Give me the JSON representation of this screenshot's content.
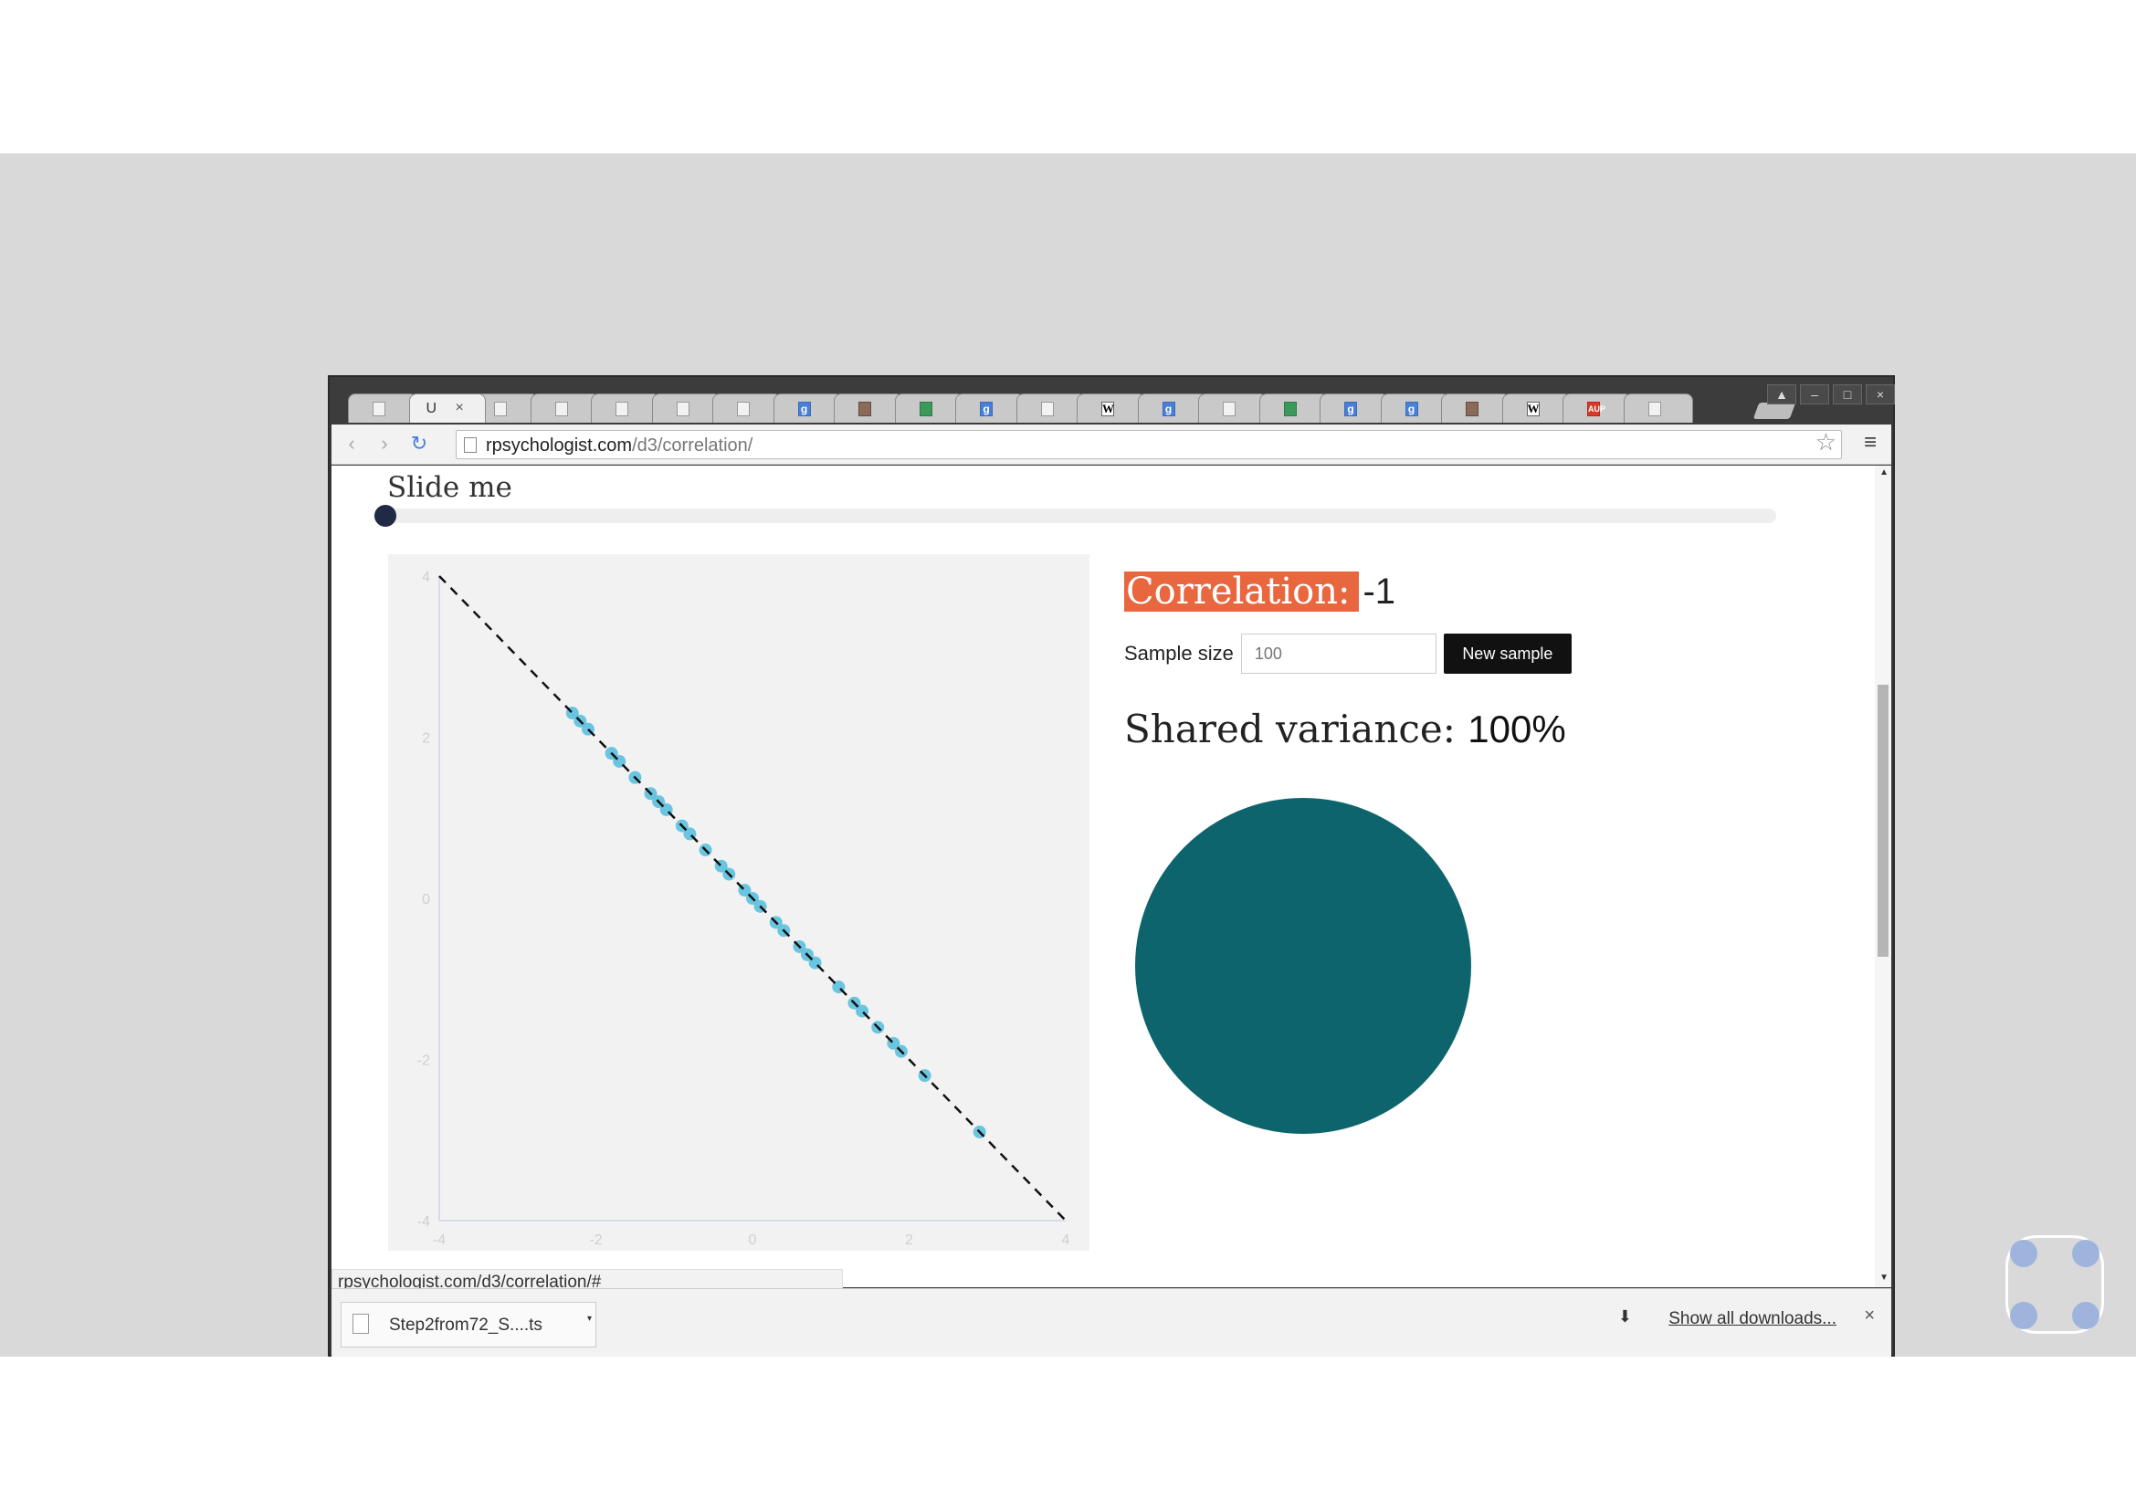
{
  "browser": {
    "active_tab_title": "U",
    "active_tab_close": "×",
    "tabs": [
      "doc",
      "doc",
      "doc",
      "doc",
      "doc",
      "doc",
      "g",
      "pic",
      "gr",
      "g",
      "doc",
      "W",
      "g",
      "doc",
      "gr",
      "g",
      "g",
      "pic",
      "W",
      "AUP",
      "doc"
    ],
    "url_host": "rpsychologist.com",
    "url_path": "/d3/correlation/",
    "window_buttons": [
      "▲",
      "–",
      "□",
      "×"
    ]
  },
  "page": {
    "slider_label": "Slide me",
    "slider_value": 0,
    "correlation_label": "Correlation:",
    "correlation_value": "-1",
    "sample_size_label": "Sample size",
    "sample_size_placeholder": "100",
    "new_sample_button": "New sample",
    "shared_variance_label": "Shared variance:",
    "shared_variance_value": "100%",
    "circle_color": "#0e646c",
    "point_color": "#5bc0de",
    "accent_color": "#e8673f"
  },
  "status_bar": {
    "link_url": "rpsychologist.com/d3/correlation/#"
  },
  "downloads": {
    "file_name": "Step2from72_S....ts",
    "show_all": "Show all downloads..."
  },
  "chart_data": {
    "type": "scatter",
    "x_ticks": [
      -4,
      -2,
      0,
      2,
      4
    ],
    "y_ticks": [
      4,
      2,
      0,
      -2,
      -4
    ],
    "xlim": [
      -4,
      4
    ],
    "ylim": [
      -4,
      4
    ],
    "regression_line": {
      "x": [
        -4,
        4
      ],
      "y": [
        4,
        -4
      ],
      "style": "dashed"
    },
    "points_x": [
      -2.3,
      -2.2,
      -2.1,
      -1.8,
      -1.7,
      -1.5,
      -1.3,
      -1.2,
      -1.1,
      -0.9,
      -0.8,
      -0.6,
      -0.4,
      -0.3,
      -0.1,
      0.0,
      0.1,
      0.3,
      0.4,
      0.6,
      0.7,
      0.8,
      1.1,
      1.3,
      1.4,
      1.6,
      1.8,
      1.9,
      2.2,
      2.9
    ],
    "points_y": [
      2.3,
      2.2,
      2.1,
      1.8,
      1.7,
      1.5,
      1.3,
      1.2,
      1.1,
      0.9,
      0.8,
      0.6,
      0.4,
      0.3,
      0.1,
      0.0,
      -0.1,
      -0.3,
      -0.4,
      -0.6,
      -0.7,
      -0.8,
      -1.1,
      -1.3,
      -1.4,
      -1.6,
      -1.8,
      -1.9,
      -2.2,
      -2.9
    ]
  }
}
